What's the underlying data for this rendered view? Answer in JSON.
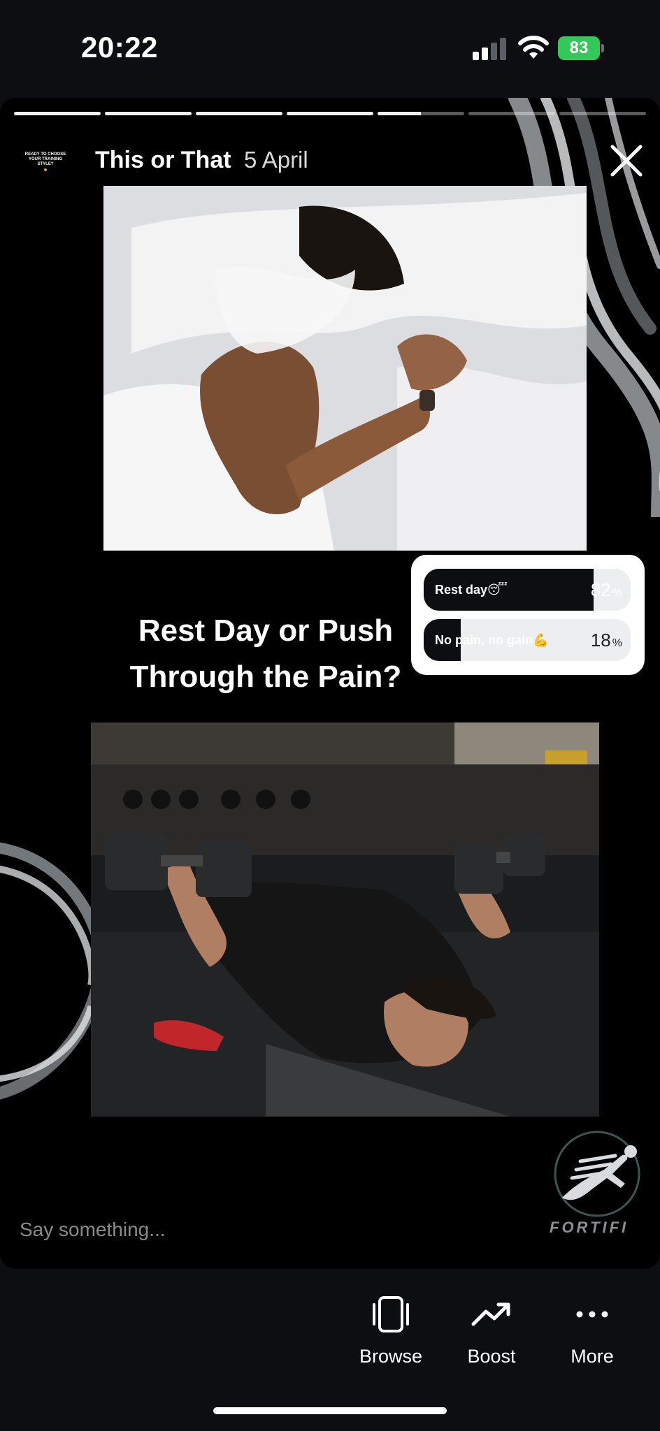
{
  "status_bar": {
    "time": "20:22",
    "battery_percent": "83",
    "signal_bars_active": 2,
    "signal_bars_total": 4
  },
  "story": {
    "progress_segments_total": 7,
    "progress_segments_done": 4,
    "progress_current_fraction": 0.5,
    "avatar_text": "READY TO CHOOSE YOUR TRAINING STYLE?",
    "title": "This or That",
    "date": "5 April",
    "question": "Rest Day or Push Through the Pain?",
    "poll": {
      "options": [
        {
          "label": "Rest day",
          "emoji": "😴",
          "percent": 82,
          "percent_text": "82"
        },
        {
          "label": "No pain, no gain",
          "emoji": "💪",
          "percent": 18,
          "percent_text": "18"
        }
      ],
      "percent_sign": "%"
    },
    "reply_placeholder": "Say something...",
    "brand_name": "FORTIFI",
    "icons": {
      "close": "close-icon",
      "logo": "runner-logo-icon"
    }
  },
  "actions": [
    {
      "label": "Browse",
      "icon": "browse-icon"
    },
    {
      "label": "Boost",
      "icon": "trend-up-icon"
    },
    {
      "label": "More",
      "icon": "more-dots-icon"
    }
  ],
  "colors": {
    "background": "#0c0e12",
    "story_background": "#000000",
    "battery": "#35c759",
    "poll_fill": "#0c0e12",
    "poll_track": "#eceef0"
  }
}
